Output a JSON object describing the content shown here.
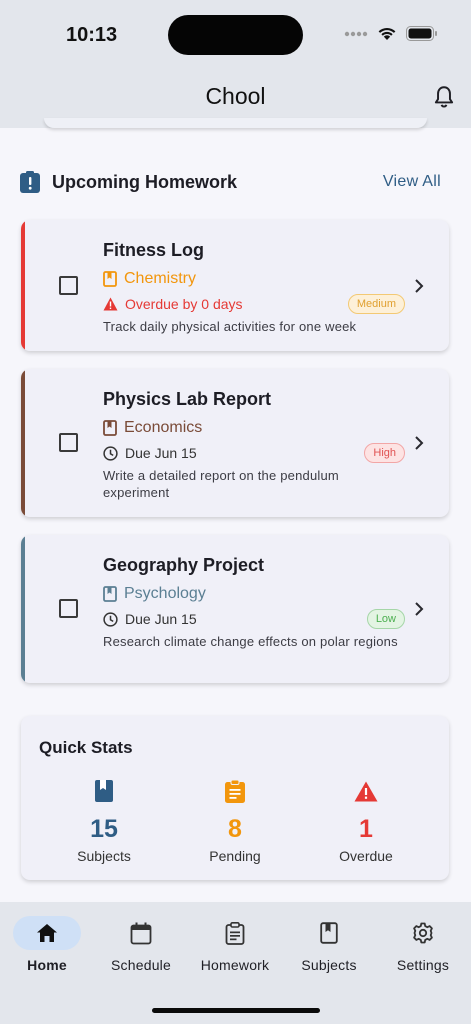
{
  "status_bar": {
    "time": "10:13"
  },
  "app_bar": {
    "title": "Chool"
  },
  "section": {
    "title": "Upcoming Homework",
    "view_all": "View All"
  },
  "homework": [
    {
      "title": "Fitness Log",
      "subject": "Chemistry",
      "subject_color": "#f2960d",
      "stripe_color": "#e53935",
      "due": "Overdue by 0 days",
      "due_color": "#e53935",
      "overdue": true,
      "priority": "Medium",
      "priority_color": "#e0a030",
      "priority_bg": "#fdf0d8",
      "description": "Track daily physical activities for one week"
    },
    {
      "title": "Physics Lab Report",
      "subject": "Economics",
      "subject_color": "#7a4b38",
      "stripe_color": "#7a4b38",
      "due": "Due Jun 15",
      "due_color": "#333333",
      "overdue": false,
      "priority": "High",
      "priority_color": "#e05252",
      "priority_bg": "#fde3e3",
      "description": "Write a detailed report on the pendulum experiment"
    },
    {
      "title": "Geography Project",
      "subject": "Psychology",
      "subject_color": "#5b7f93",
      "stripe_color": "#5b7f93",
      "due": "Due Jun 15",
      "due_color": "#333333",
      "overdue": false,
      "priority": "Low",
      "priority_color": "#4caf50",
      "priority_bg": "#e3f4e3",
      "description": "Research climate change effects on polar regions"
    }
  ],
  "quick_stats": {
    "title": "Quick Stats",
    "items": [
      {
        "value": "15",
        "label": "Subjects",
        "color": "#2f5d85",
        "icon": "book-icon"
      },
      {
        "value": "8",
        "label": "Pending",
        "color": "#f2960d",
        "icon": "clipboard-icon"
      },
      {
        "value": "1",
        "label": "Overdue",
        "color": "#e53935",
        "icon": "warning-icon"
      }
    ]
  },
  "tabs": [
    {
      "label": "Home",
      "icon": "home-icon",
      "active": true
    },
    {
      "label": "Schedule",
      "icon": "calendar-icon",
      "active": false
    },
    {
      "label": "Homework",
      "icon": "clipboard-icon",
      "active": false
    },
    {
      "label": "Subjects",
      "icon": "book-icon",
      "active": false
    },
    {
      "label": "Settings",
      "icon": "gear-icon",
      "active": false
    }
  ]
}
